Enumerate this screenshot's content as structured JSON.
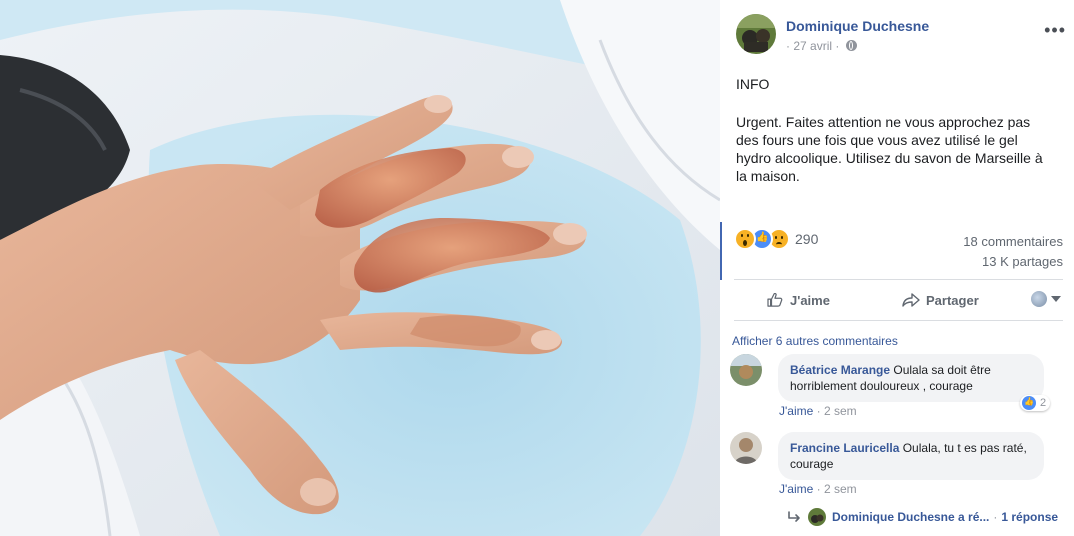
{
  "post": {
    "author": "Dominique Duchesne",
    "date": "27 avril",
    "date_separator": "·",
    "more_label": "•••",
    "text_heading": "INFO",
    "text_body": "Urgent. Faites attention ne vous approchez pas des fours une fois que vous avez utilisé le gel hydro alcoolique. Utilisez du savon de Marseille à la maison.",
    "reactions_count": "290",
    "comments_count": "18 commentaires",
    "shares_count": "13 K partages"
  },
  "actions": {
    "like_label": "J'aime",
    "share_label": "Partager"
  },
  "comments": {
    "show_more": "Afficher 6 autres commentaires",
    "items": [
      {
        "name": "Béatrice Marange",
        "text": " Oulala sa doit être horriblement douloureux , courage",
        "like": "J'aime",
        "time": "2 sem",
        "reaction_count": "2"
      },
      {
        "name": "Francine Lauricella",
        "text": " Oulala, tu t es pas raté, courage",
        "like": "J'aime",
        "time": "2 sem"
      }
    ],
    "reply": {
      "name": "Dominique Duchesne a ré...",
      "count": "1 réponse"
    }
  },
  "icons": {
    "globe": "globe-icon",
    "like": "thumbs-up-icon",
    "share": "share-arrow-icon",
    "reply": "reply-arrow-icon"
  },
  "colors": {
    "link_blue": "#385898",
    "accent": "#4267b2",
    "text_gray": "#606770"
  }
}
